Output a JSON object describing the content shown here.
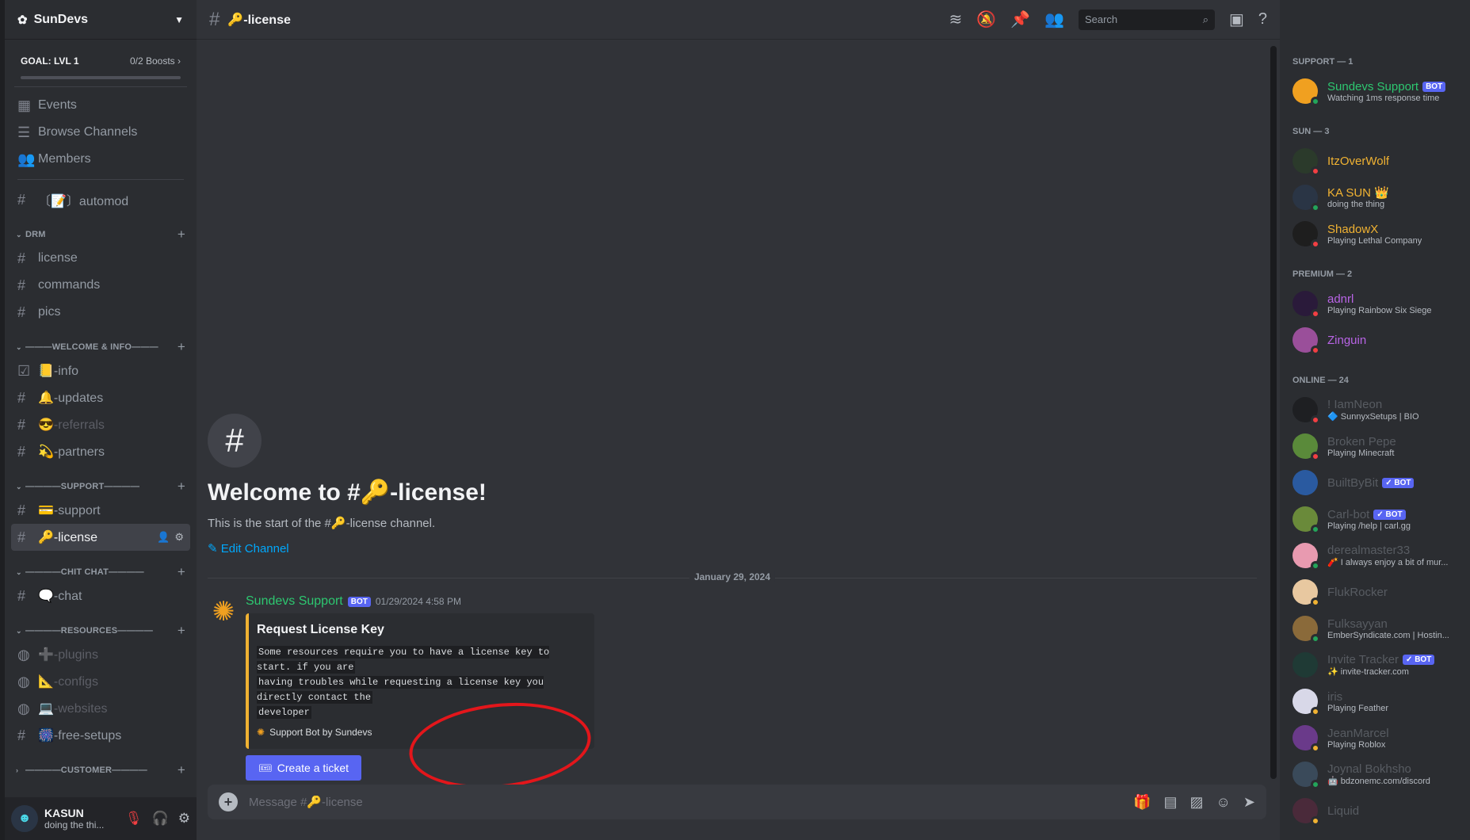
{
  "server": {
    "name": "SunDevs"
  },
  "goal": {
    "label": "GOAL: LVL 1",
    "boosts": "0/2 Boosts"
  },
  "nav": {
    "events": "Events",
    "browse": "Browse Channels",
    "members": "Members"
  },
  "channels": {
    "automod": "〔📝〕automod",
    "drm_cat": "DRM",
    "drm": [
      "license",
      "commands",
      "pics"
    ],
    "welcome_cat": "———WELCOME & INFO———",
    "welcome": [
      "📒-info",
      "🔔-updates",
      "😎-referrals",
      "💫-partners"
    ],
    "support_cat": "————SUPPORT————",
    "support": [
      "💳-support",
      "🔑-license"
    ],
    "chit_cat": "————CHIT CHAT————",
    "chit": [
      "🗨️-chat"
    ],
    "res_cat": "————RESOURCES————",
    "resources": [
      "➕-plugins",
      "📐-configs",
      "💻-websites",
      "🎆-free-setups"
    ],
    "cust_cat": "————CUSTOMER————"
  },
  "user": {
    "name": "KASUN",
    "status": "doing the thi..."
  },
  "topbar": {
    "channel": "🔑-license",
    "search_placeholder": "Search"
  },
  "welcome": {
    "title": "Welcome to #🔑-license!",
    "subtitle": "This is the start of the #🔑-license channel.",
    "edit": "Edit Channel"
  },
  "date_divider": "January 29, 2024",
  "message": {
    "author": "Sundevs Support",
    "bot_tag": "BOT",
    "time": "01/29/2024 4:58 PM",
    "embed_title": "Request License Key",
    "embed_lines": [
      "Some resources require you to have a license key to start. if you are",
      "having troubles while requesting a license key you directly contact the",
      "developer"
    ],
    "embed_footer": "Support Bot by Sundevs",
    "button": "Create a ticket"
  },
  "composer": {
    "placeholder": "Message #🔑-license"
  },
  "members": {
    "groups": [
      {
        "label": "SUPPORT — 1",
        "items": [
          {
            "name": "Sundevs Support",
            "bot": "BOT",
            "status": "Watching 1ms response time",
            "color": "#2dc770",
            "av": "#f0a020",
            "st": "#23a55a"
          }
        ]
      },
      {
        "label": "SUN — 3",
        "items": [
          {
            "name": "ItzOverWolf",
            "status": "",
            "color": "#f0b232",
            "av": "#2b3a2b",
            "st": "#f23f43"
          },
          {
            "name": "KA SUN 👑",
            "status": "doing the thing",
            "color": "#f0b232",
            "av": "#2a3545",
            "st": "#23a55a"
          },
          {
            "name": "ShadowX",
            "status": "Playing Lethal Company",
            "color": "#f0b232",
            "av": "#1e1e1e",
            "st": "#f23f43"
          }
        ]
      },
      {
        "label": "PREMIUM — 2",
        "items": [
          {
            "name": "adnrl",
            "status": "Playing Rainbow Six Siege",
            "color": "#b964e6",
            "av": "#2a1a3a",
            "st": "#f23f43"
          },
          {
            "name": "Zinguin",
            "status": "",
            "color": "#b964e6",
            "av": "#9a4f9a",
            "st": "#f23f43"
          }
        ]
      },
      {
        "label": "ONLINE — 24",
        "items": [
          {
            "name": "! IamNeon",
            "status": "🔷 SunnyxSetups | BIO",
            "color": "#949ba4",
            "av": "#1e1f22",
            "st": "#f23f43"
          },
          {
            "name": "Broken Pepe",
            "status": "Playing Minecraft",
            "color": "#949ba4",
            "av": "#5a8a3a",
            "st": "#f23f43"
          },
          {
            "name": "BuiltByBit",
            "bot": "✓ BOT",
            "status": "",
            "color": "#949ba4",
            "av": "#2a5aa0",
            "st": ""
          },
          {
            "name": "Carl-bot",
            "bot": "✓ BOT",
            "status": "Playing /help | carl.gg",
            "color": "#949ba4",
            "av": "#6a8a3a",
            "st": "#23a55a"
          },
          {
            "name": "derealmaster33",
            "status": "🧨 I always enjoy a bit of mur...",
            "color": "#949ba4",
            "av": "#e89ab0",
            "st": "#23a55a"
          },
          {
            "name": "FlukRocker",
            "status": "",
            "color": "#949ba4",
            "av": "#e8c8a0",
            "st": "#f0b232"
          },
          {
            "name": "Fulksayyan",
            "status": "EmberSyndicate.com | Hostin...",
            "color": "#949ba4",
            "av": "#8a6a3a",
            "st": "#23a55a"
          },
          {
            "name": "Invite Tracker",
            "bot": "✓ BOT",
            "status": "✨ invite-tracker.com",
            "color": "#949ba4",
            "av": "#1f3a35",
            "st": ""
          },
          {
            "name": "iris",
            "status": "Playing Feather",
            "color": "#949ba4",
            "av": "#d8d8e8",
            "st": "#f0b232"
          },
          {
            "name": "JeanMarcel",
            "status": "Playing Roblox",
            "color": "#949ba4",
            "av": "#6a3a8a",
            "st": "#f0b232"
          },
          {
            "name": "Joynal Bokhsho",
            "status": "🤖 bdzonemc.com/discord",
            "color": "#949ba4",
            "av": "#3a4a5a",
            "st": "#23a55a"
          },
          {
            "name": "Liquid",
            "status": "",
            "color": "#949ba4",
            "av": "#4a2a3a",
            "st": "#f0b232"
          }
        ]
      }
    ]
  }
}
